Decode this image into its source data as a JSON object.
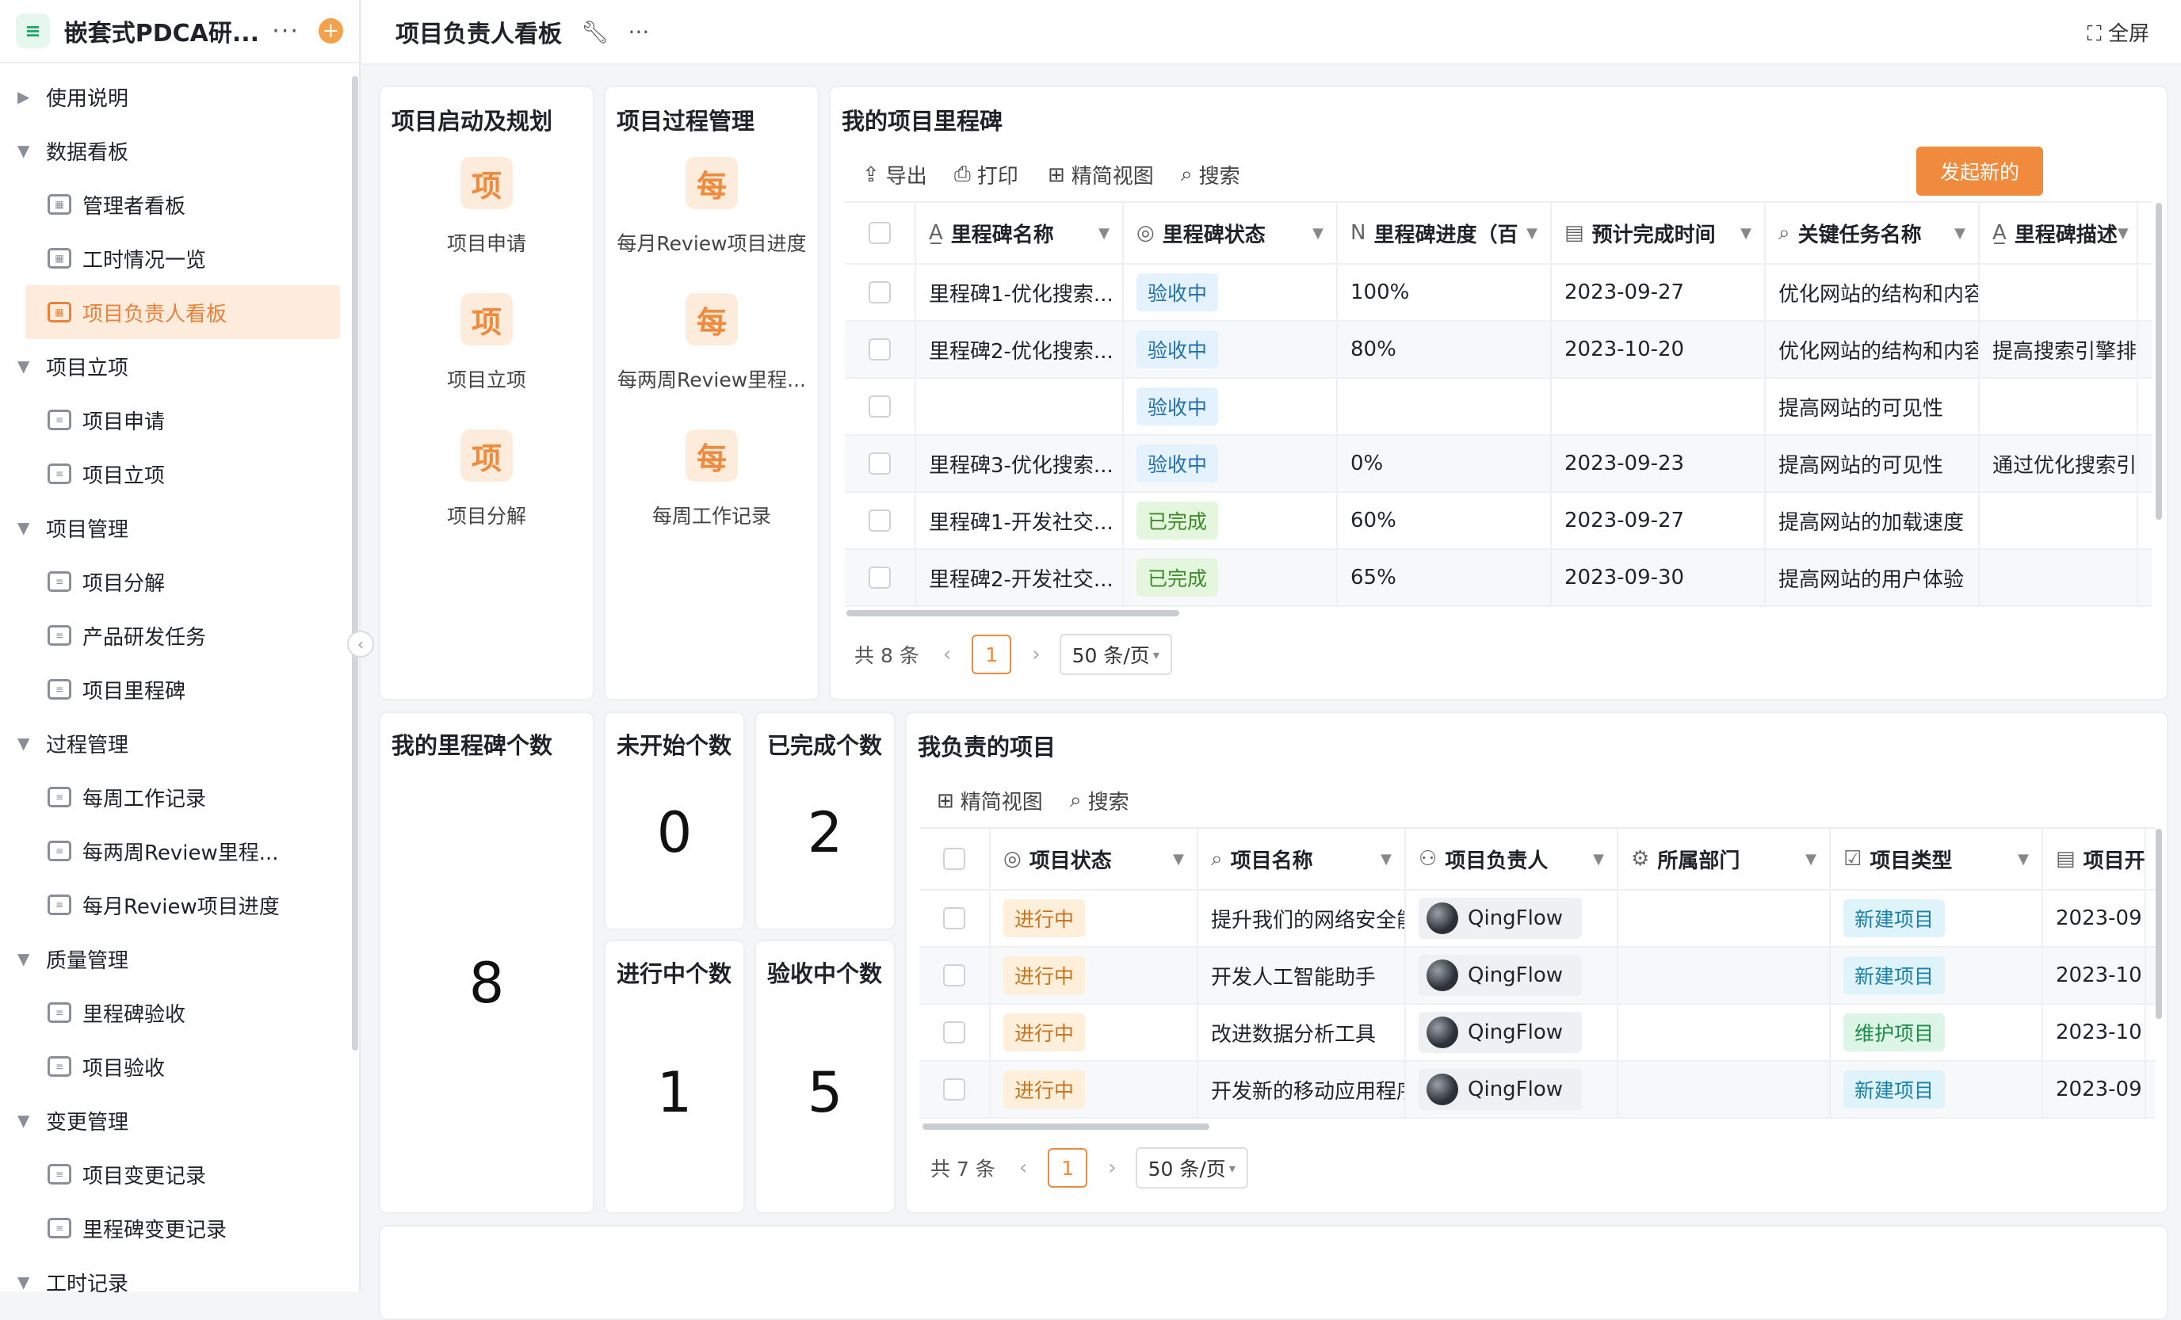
{
  "app": {
    "title": "嵌套式PDCA研...",
    "logo_icon": "database-icon"
  },
  "sidebar": {
    "nodes": [
      {
        "type": "group",
        "label": "使用说明",
        "expanded": false
      },
      {
        "type": "group",
        "label": "数据看板",
        "expanded": true
      },
      {
        "type": "item",
        "label": "管理者看板",
        "icon": "dashboard-icon"
      },
      {
        "type": "item",
        "label": "工时情况一览",
        "icon": "dashboard-icon"
      },
      {
        "type": "item",
        "label": "项目负责人看板",
        "icon": "dashboard-icon",
        "active": true
      },
      {
        "type": "group",
        "label": "项目立项",
        "expanded": true
      },
      {
        "type": "item",
        "label": "项目申请",
        "icon": "form-icon"
      },
      {
        "type": "item",
        "label": "项目立项",
        "icon": "form-icon"
      },
      {
        "type": "group",
        "label": "项目管理",
        "expanded": true
      },
      {
        "type": "item",
        "label": "项目分解",
        "icon": "form-icon"
      },
      {
        "type": "item",
        "label": "产品研发任务",
        "icon": "form-icon"
      },
      {
        "type": "item",
        "label": "项目里程碑",
        "icon": "form-icon"
      },
      {
        "type": "group",
        "label": "过程管理",
        "expanded": true
      },
      {
        "type": "item",
        "label": "每周工作记录",
        "icon": "form-icon"
      },
      {
        "type": "item",
        "label": "每两周Review里程...",
        "icon": "form-icon"
      },
      {
        "type": "item",
        "label": "每月Review项目进度",
        "icon": "form-icon"
      },
      {
        "type": "group",
        "label": "质量管理",
        "expanded": true
      },
      {
        "type": "item",
        "label": "里程碑验收",
        "icon": "form-icon"
      },
      {
        "type": "item",
        "label": "项目验收",
        "icon": "form-icon"
      },
      {
        "type": "group",
        "label": "变更管理",
        "expanded": true
      },
      {
        "type": "item",
        "label": "项目变更记录",
        "icon": "form-icon"
      },
      {
        "type": "item",
        "label": "里程碑变更记录",
        "icon": "form-icon"
      },
      {
        "type": "group",
        "label": "工时记录",
        "expanded": true
      }
    ]
  },
  "header": {
    "title": "项目负责人看板",
    "fullscreen_label": "全屏"
  },
  "start_card": {
    "title": "项目启动及规划",
    "items": [
      {
        "icon_char": "项",
        "label": "项目申请"
      },
      {
        "icon_char": "项",
        "label": "项目立项"
      },
      {
        "icon_char": "项",
        "label": "项目分解"
      }
    ]
  },
  "process_card": {
    "title": "项目过程管理",
    "items": [
      {
        "icon_char": "每",
        "label": "每月Review项目进度"
      },
      {
        "icon_char": "每",
        "label": "每两周Review里程..."
      },
      {
        "icon_char": "每",
        "label": "每周工作记录"
      }
    ]
  },
  "milestones": {
    "title": "我的项目里程碑",
    "toolbar": {
      "export": "导出",
      "print": "打印",
      "compact": "精简视图",
      "search": "搜索",
      "new": "发起新的"
    },
    "columns": [
      "里程碑名称",
      "里程碑状态",
      "里程碑进度（百",
      "预计完成时间",
      "关键任务名称",
      "里程碑描述"
    ],
    "rows": [
      {
        "name": "里程碑1-优化搜索...",
        "status": "验收中",
        "status_kind": "acc",
        "progress": "100%",
        "date": "2023-09-27",
        "task": "优化网站的结构和内容",
        "desc": ""
      },
      {
        "name": "里程碑2-优化搜索...",
        "status": "验收中",
        "status_kind": "acc",
        "progress": "80%",
        "date": "2023-10-20",
        "task": "优化网站的结构和内容",
        "desc": "提高搜索引擎排名"
      },
      {
        "name": "",
        "status": "验收中",
        "status_kind": "acc",
        "progress": "",
        "date": "",
        "task": "提高网站的可见性",
        "desc": ""
      },
      {
        "name": "里程碑3-优化搜索...",
        "status": "验收中",
        "status_kind": "acc",
        "progress": "0%",
        "date": "2023-09-23",
        "task": "提高网站的可见性",
        "desc": "通过优化搜索引擎"
      },
      {
        "name": "里程碑1-开发社交...",
        "status": "已完成",
        "status_kind": "done",
        "progress": "60%",
        "date": "2023-09-27",
        "task": "提高网站的加载速度",
        "desc": ""
      },
      {
        "name": "里程碑2-开发社交...",
        "status": "已完成",
        "status_kind": "done",
        "progress": "65%",
        "date": "2023-09-30",
        "task": "提高网站的用户体验",
        "desc": ""
      }
    ],
    "pager": {
      "total": "共 8 条",
      "page": "1",
      "size": "50 条/页"
    }
  },
  "stats": {
    "total_title": "我的里程碑个数",
    "total": "8",
    "not_started_title": "未开始个数",
    "not_started": "0",
    "completed_title": "已完成个数",
    "completed": "2",
    "in_progress_title": "进行中个数",
    "in_progress": "1",
    "accepting_title": "验收中个数",
    "accepting": "5"
  },
  "projects": {
    "title": "我负责的项目",
    "toolbar": {
      "compact": "精简视图",
      "search": "搜索"
    },
    "columns": [
      "项目状态",
      "项目名称",
      "项目负责人",
      "所属部门",
      "项目类型",
      "项目开"
    ],
    "rows": [
      {
        "status": "进行中",
        "name": "提升我们的网络安全能",
        "owner": "QingFlow",
        "dept": "",
        "type": "新建项目",
        "type_kind": "new",
        "date": "2023-09"
      },
      {
        "status": "进行中",
        "name": "开发人工智能助手",
        "owner": "QingFlow",
        "dept": "",
        "type": "新建项目",
        "type_kind": "new",
        "date": "2023-10"
      },
      {
        "status": "进行中",
        "name": "改进数据分析工具",
        "owner": "QingFlow",
        "dept": "",
        "type": "维护项目",
        "type_kind": "maint",
        "date": "2023-10"
      },
      {
        "status": "进行中",
        "name": "开发新的移动应用程序",
        "owner": "QingFlow",
        "dept": "",
        "type": "新建项目",
        "type_kind": "new",
        "date": "2023-09"
      }
    ],
    "pager": {
      "total": "共 7 条",
      "page": "1",
      "size": "50 条/页"
    }
  },
  "colors": {
    "accent": "#f08a3c",
    "active_bg": "#fdebdb"
  }
}
